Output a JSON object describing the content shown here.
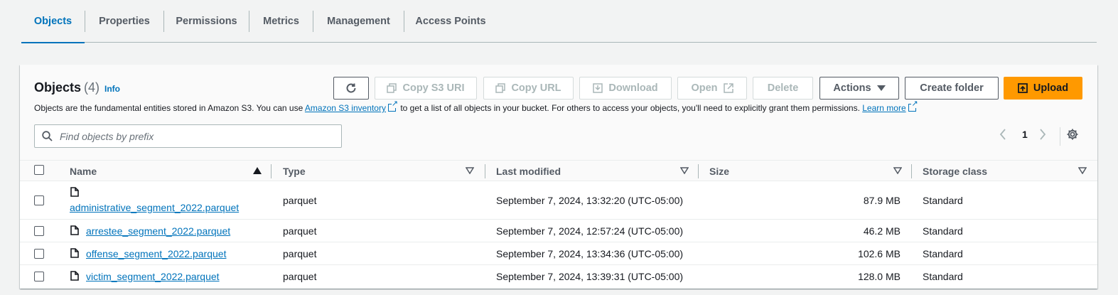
{
  "tabs": [
    {
      "label": "Objects",
      "active": true
    },
    {
      "label": "Properties"
    },
    {
      "label": "Permissions"
    },
    {
      "label": "Metrics"
    },
    {
      "label": "Management"
    },
    {
      "label": "Access Points"
    }
  ],
  "objects_panel": {
    "title": "Objects",
    "count": "(4)",
    "info_link": "Info",
    "description_before": "Objects are the fundamental entities stored in Amazon S3. You can use ",
    "inventory_link": "Amazon S3 inventory",
    "description_middle": " to get a list of all objects in your bucket. For others to access your objects, you'll need to explicitly grant them permissions. ",
    "learn_more_link": "Learn more"
  },
  "toolbar": {
    "refresh_icon": "refresh-icon",
    "copy_s3_uri": "Copy S3 URI",
    "copy_url": "Copy URL",
    "download": "Download",
    "open": "Open",
    "delete": "Delete",
    "actions": "Actions",
    "create_folder": "Create folder",
    "upload": "Upload"
  },
  "search": {
    "placeholder": "Find objects by prefix",
    "value": ""
  },
  "pagination": {
    "current_page": "1"
  },
  "table": {
    "columns": [
      "Name",
      "Type",
      "Last modified",
      "Size",
      "Storage class"
    ],
    "rows": [
      {
        "name": "administrative_segment_2022.parquet",
        "type": "parquet",
        "last_modified": "September 7, 2024, 13:32:20 (UTC-05:00)",
        "size": "87.9 MB",
        "storage_class": "Standard"
      },
      {
        "name": "arrestee_segment_2022.parquet",
        "type": "parquet",
        "last_modified": "September 7, 2024, 12:57:24 (UTC-05:00)",
        "size": "46.2 MB",
        "storage_class": "Standard"
      },
      {
        "name": "offense_segment_2022.parquet",
        "type": "parquet",
        "last_modified": "September 7, 2024, 13:34:36 (UTC-05:00)",
        "size": "102.6 MB",
        "storage_class": "Standard"
      },
      {
        "name": "victim_segment_2022.parquet",
        "type": "parquet",
        "last_modified": "September 7, 2024, 13:39:31 (UTC-05:00)",
        "size": "128.0 MB",
        "storage_class": "Standard"
      }
    ]
  },
  "colors": {
    "accent": "#0073bb",
    "primary_button": "#ff9900",
    "text": "#16191f",
    "muted": "#545b64"
  }
}
